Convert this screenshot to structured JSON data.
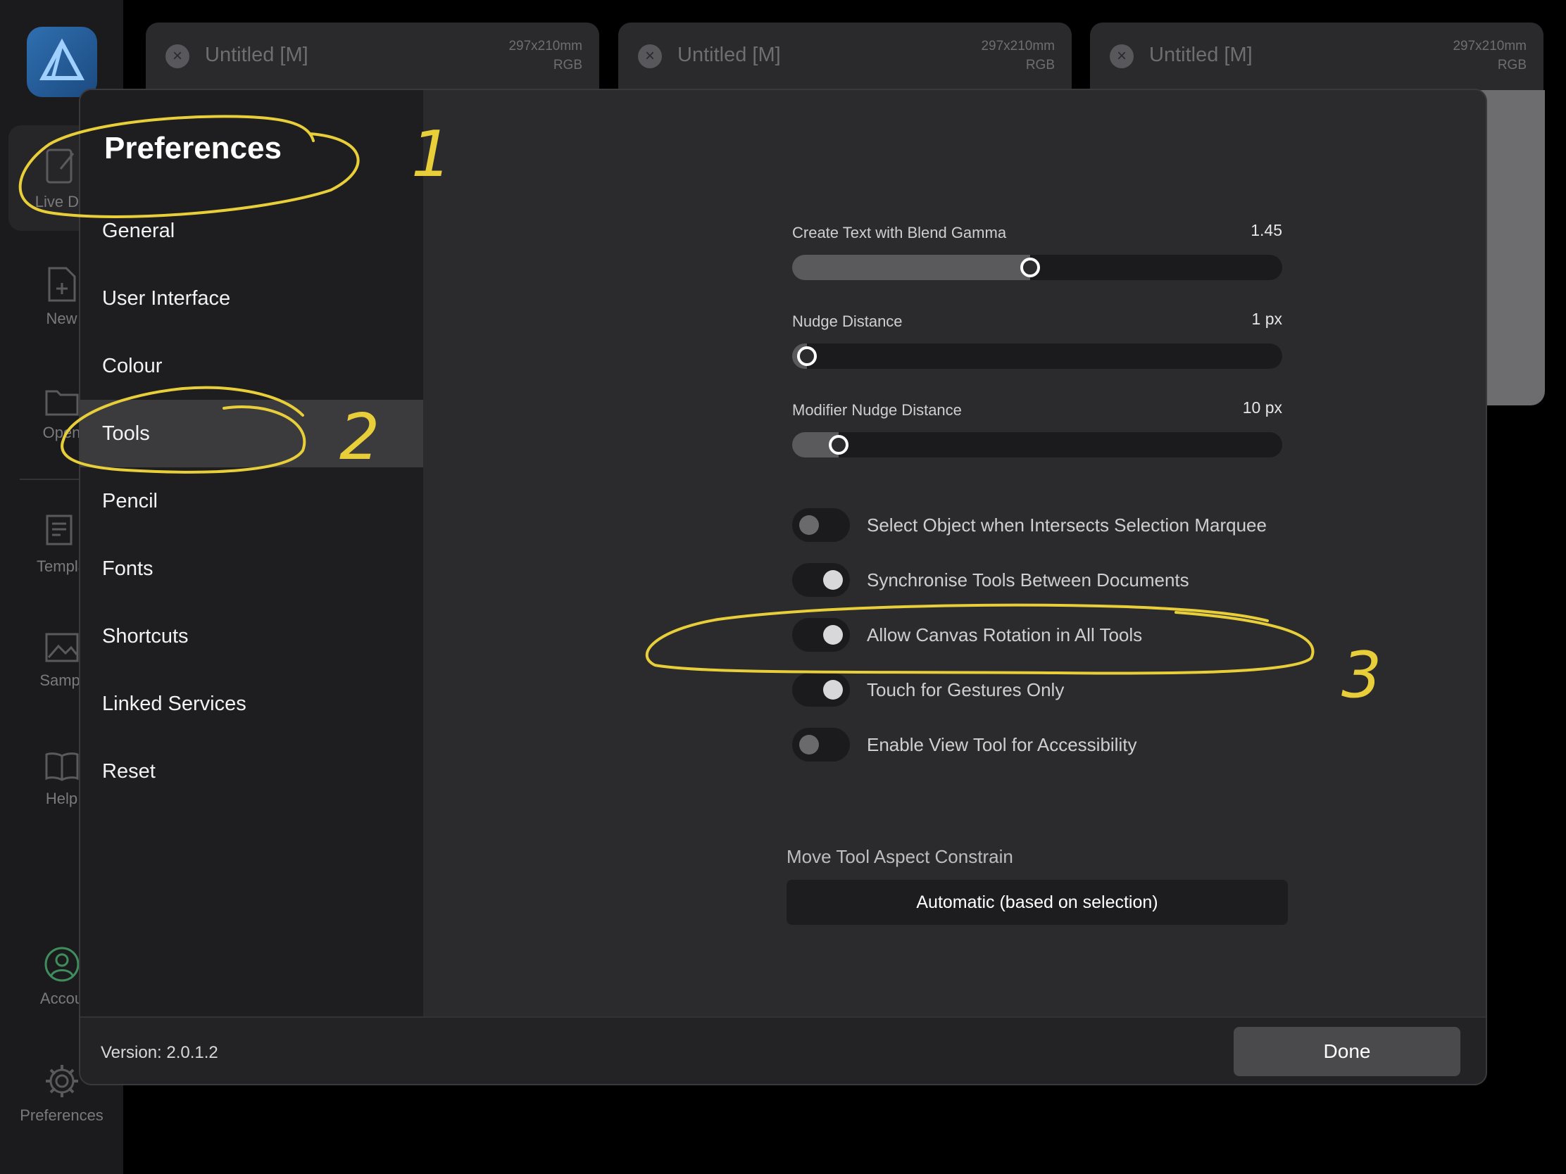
{
  "app": {
    "rail": [
      {
        "label": "Live Do",
        "icon": "pencil-doc-icon"
      },
      {
        "label": "New",
        "icon": "new-doc-icon"
      },
      {
        "label": "Open",
        "icon": "folder-icon"
      },
      {
        "label": "Templa",
        "icon": "template-icon"
      },
      {
        "label": "Sampl",
        "icon": "sample-icon"
      },
      {
        "label": "Help",
        "icon": "book-icon"
      },
      {
        "label": "Accou",
        "icon": "account-icon"
      },
      {
        "label": "Preferences",
        "icon": "gear-icon"
      }
    ],
    "tabs": [
      {
        "title": "Untitled [M]",
        "size": "297x210mm",
        "mode": "RGB"
      },
      {
        "title": "Untitled [M]",
        "size": "297x210mm",
        "mode": "RGB"
      },
      {
        "title": "Untitled [M]",
        "size": "297x210mm",
        "mode": "RGB"
      }
    ]
  },
  "preferences": {
    "title": "Preferences",
    "nav": [
      "General",
      "User Interface",
      "Colour",
      "Tools",
      "Pencil",
      "Fonts",
      "Shortcuts",
      "Linked Services",
      "Reset"
    ],
    "selected_nav": "Tools",
    "sliders": [
      {
        "label": "Create Text with Blend Gamma",
        "value": "1.45",
        "fraction": 0.485
      },
      {
        "label": "Nudge Distance",
        "value": "1 px",
        "fraction": 0.0
      },
      {
        "label": "Modifier Nudge Distance",
        "value": "10 px",
        "fraction": 0.095
      }
    ],
    "toggles": [
      {
        "label": "Select Object when Intersects Selection Marquee",
        "on": false
      },
      {
        "label": "Synchronise Tools Between Documents",
        "on": true
      },
      {
        "label": "Allow Canvas Rotation in All Tools",
        "on": true
      },
      {
        "label": "Touch for Gestures Only",
        "on": true
      },
      {
        "label": "Enable View Tool for Accessibility",
        "on": false
      }
    ],
    "aspect": {
      "label": "Move Tool Aspect Constrain",
      "value": "Automatic (based on selection)"
    },
    "version": "Version: 2.0.1.2",
    "done": "Done"
  },
  "handwritten": [
    "1",
    "2",
    "3"
  ],
  "colors": {
    "annotation": "#e8cf3a",
    "background": "#000000",
    "panel": "#2b2b2d",
    "sidebar": "#1e1e20",
    "selected": "#3b3b3e"
  }
}
